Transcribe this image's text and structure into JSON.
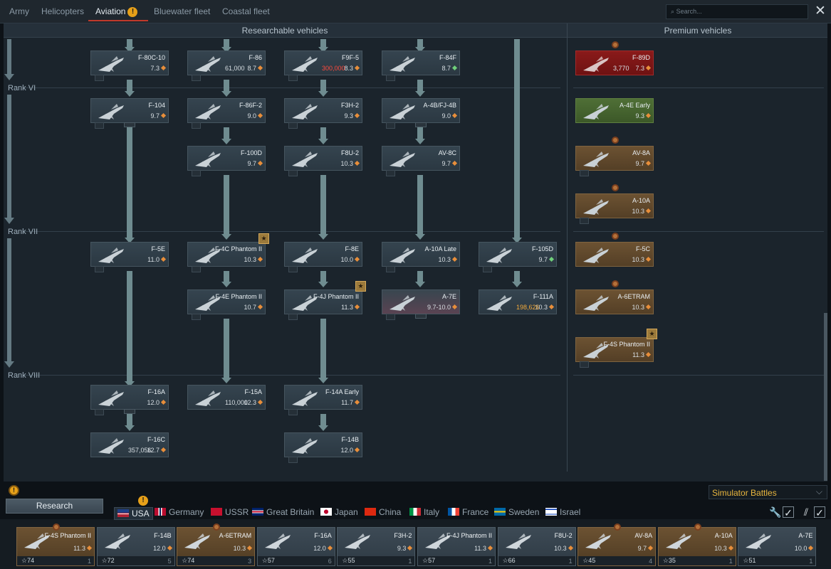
{
  "tabs": [
    "Army",
    "Helicopters",
    "Aviation",
    "Bluewater fleet",
    "Coastal fleet"
  ],
  "active_tab": "Aviation",
  "search_placeholder": "Search...",
  "sections": {
    "researchable": "Researchable vehicles",
    "premium": "Premium vehicles"
  },
  "ranks": [
    "Rank VI",
    "Rank VII",
    "Rank VIII"
  ],
  "cards": [
    {
      "name": "F-80C-10",
      "br": "7.3",
      "dot": "orange"
    },
    {
      "name": "F-86",
      "price": "61,000",
      "br": "8.7",
      "dot": "orange"
    },
    {
      "name": "F9F-5",
      "price": "300,000",
      "br": "8.3",
      "dot": "orange",
      "price_color": "red"
    },
    {
      "name": "F-84F",
      "br": "8.7",
      "dot": "green"
    },
    {
      "name": "F-89D",
      "price": "3,770",
      "br": "7.3",
      "dot": "orange",
      "premium": "red"
    },
    {
      "name": "F-104",
      "br": "9.7",
      "dot": "orange"
    },
    {
      "name": "F-86F-2",
      "br": "9.0",
      "dot": "orange"
    },
    {
      "name": "F3H-2",
      "br": "9.3",
      "dot": "orange"
    },
    {
      "name": "A-4B/FJ-4B",
      "br": "9.0",
      "dot": "orange"
    },
    {
      "name": "A-4E Early",
      "br": "9.3",
      "dot": "orange",
      "premium": "green"
    },
    {
      "name": "F-100D",
      "br": "9.7",
      "dot": "orange"
    },
    {
      "name": "F8U-2",
      "br": "10.3",
      "dot": "orange"
    },
    {
      "name": "AV-8C",
      "br": "9.7",
      "dot": "orange"
    },
    {
      "name": "AV-8A",
      "br": "9.7",
      "dot": "orange",
      "premium": "gold"
    },
    {
      "name": "A-10A",
      "br": "10.3",
      "dot": "orange",
      "premium": "gold"
    },
    {
      "name": "F-5E",
      "br": "11.0",
      "dot": "orange"
    },
    {
      "name": "F-4C Phantom II",
      "br": "10.3",
      "dot": "orange"
    },
    {
      "name": "F-8E",
      "br": "10.0",
      "dot": "orange"
    },
    {
      "name": "A-10A Late",
      "br": "10.3",
      "dot": "orange"
    },
    {
      "name": "F-105D",
      "br": "9.7",
      "dot": "green"
    },
    {
      "name": "F-5C",
      "br": "10.3",
      "dot": "orange",
      "premium": "gold"
    },
    {
      "name": "F-4E Phantom II",
      "br": "10.7",
      "dot": "orange"
    },
    {
      "name": "F-4J Phantom II",
      "br": "11.3",
      "dot": "orange"
    },
    {
      "name": "A-7E",
      "br": "9.7-10.0",
      "dot": "orange"
    },
    {
      "name": "F-111A",
      "price": "198,626",
      "br": "10.3",
      "dot": "orange",
      "price_color": "orange"
    },
    {
      "name": "A-6ETRAM",
      "br": "10.3",
      "dot": "orange",
      "premium": "gold"
    },
    {
      "name": "F-4S Phantom II",
      "br": "11.3",
      "dot": "orange",
      "premium": "gold"
    },
    {
      "name": "F-16A",
      "br": "12.0",
      "dot": "orange"
    },
    {
      "name": "F-15A",
      "price": "110,000",
      "br": "12.3",
      "dot": "orange"
    },
    {
      "name": "F-14A Early",
      "br": "11.7",
      "dot": "orange"
    },
    {
      "name": "F-16C",
      "price": "357,056",
      "br": "12.7",
      "dot": "orange"
    },
    {
      "name": "F-14B",
      "br": "12.0",
      "dot": "orange"
    }
  ],
  "mode": "Simulator Battles",
  "research_label": "Research",
  "nations": [
    "USA",
    "Germany",
    "USSR",
    "Great Britain",
    "Japan",
    "China",
    "Italy",
    "France",
    "Sweden",
    "Israel"
  ],
  "active_nation": "USA",
  "slots": [
    {
      "name": "F-4S Phantom II",
      "br": "11.3",
      "crew": "74",
      "count": "1",
      "gold": true
    },
    {
      "name": "F-14B",
      "br": "12.0",
      "crew": "72",
      "count": "5",
      "gold": false
    },
    {
      "name": "A-6ETRAM",
      "br": "10.3",
      "crew": "74",
      "count": "3",
      "gold": true
    },
    {
      "name": "F-16A",
      "br": "12.0",
      "crew": "57",
      "count": "6",
      "gold": false
    },
    {
      "name": "F3H-2",
      "br": "9.3",
      "crew": "55",
      "count": "1",
      "gold": false
    },
    {
      "name": "F-4J Phantom II",
      "br": "11.3",
      "crew": "57",
      "count": "1",
      "gold": false
    },
    {
      "name": "F8U-2",
      "br": "10.3",
      "crew": "66",
      "count": "1",
      "gold": false
    },
    {
      "name": "AV-8A",
      "br": "9.7",
      "crew": "45",
      "count": "4",
      "gold": true
    },
    {
      "name": "A-10A",
      "br": "10.3",
      "crew": "35",
      "count": "1",
      "gold": true
    },
    {
      "name": "A-7E",
      "br": "10.0",
      "crew": "51",
      "count": "1",
      "gold": false
    }
  ],
  "colors": {
    "accent_red": "#c0392b",
    "gold": "#e8b53e",
    "warning": "#e6a019"
  }
}
